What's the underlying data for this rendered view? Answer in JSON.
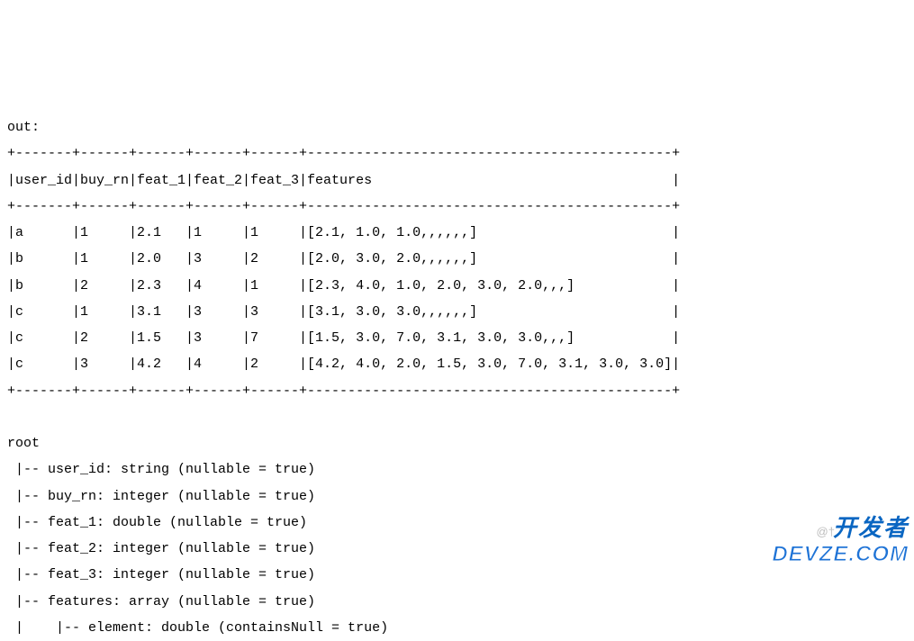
{
  "out_label": "out:",
  "table_border_line": "+-------+------+------+------+------+---------------------------------------------+",
  "table_header_raw": "|user_id|buy_rn|feat_1|feat_2|feat_3|features                                     |",
  "columns": [
    "user_id",
    "buy_rn",
    "feat_1",
    "feat_2",
    "feat_3",
    "features"
  ],
  "rows_raw": [
    "|a      |1     |2.1   |1     |1     |[2.1, 1.0, 1.0,,,,,,]                        |",
    "|b      |1     |2.0   |3     |2     |[2.0, 3.0, 2.0,,,,,,]                        |",
    "|b      |2     |2.3   |4     |1     |[2.3, 4.0, 1.0, 2.0, 3.0, 2.0,,,]            |",
    "|c      |1     |3.1   |3     |3     |[3.1, 3.0, 3.0,,,,,,]                        |",
    "|c      |2     |1.5   |3     |7     |[1.5, 3.0, 7.0, 3.1, 3.0, 3.0,,,]            |",
    "|c      |3     |4.2   |4     |2     |[4.2, 4.0, 2.0, 1.5, 3.0, 7.0, 3.1, 3.0, 3.0]|"
  ],
  "rows": [
    {
      "user_id": "a",
      "buy_rn": 1,
      "feat_1": 2.1,
      "feat_2": 1,
      "feat_3": 1,
      "features": "[2.1, 1.0, 1.0,,,,,,]"
    },
    {
      "user_id": "b",
      "buy_rn": 1,
      "feat_1": 2.0,
      "feat_2": 3,
      "feat_3": 2,
      "features": "[2.0, 3.0, 2.0,,,,,,]"
    },
    {
      "user_id": "b",
      "buy_rn": 2,
      "feat_1": 2.3,
      "feat_2": 4,
      "feat_3": 1,
      "features": "[2.3, 4.0, 1.0, 2.0, 3.0, 2.0,,,]"
    },
    {
      "user_id": "c",
      "buy_rn": 1,
      "feat_1": 3.1,
      "feat_2": 3,
      "feat_3": 3,
      "features": "[3.1, 3.0, 3.0,,,,,,]"
    },
    {
      "user_id": "c",
      "buy_rn": 2,
      "feat_1": 1.5,
      "feat_2": 3,
      "feat_3": 7,
      "features": "[1.5, 3.0, 7.0, 3.1, 3.0, 3.0,,,]"
    },
    {
      "user_id": "c",
      "buy_rn": 3,
      "feat_1": 4.2,
      "feat_2": 4,
      "feat_3": 2,
      "features": "[4.2, 4.0, 2.0, 1.5, 3.0, 7.0, 3.1, 3.0, 3.0]"
    }
  ],
  "schema_header": "root",
  "schema_lines": [
    " |-- user_id: string (nullable = true)",
    " |-- buy_rn: integer (nullable = true)",
    " |-- feat_1: double (nullable = true)",
    " |-- feat_2: integer (nullable = true)",
    " |-- feat_3: integer (nullable = true)",
    " |-- features: array (nullable = true)",
    " |    |-- element: double (containsNull = true)"
  ],
  "schema": [
    {
      "name": "user_id",
      "type": "string",
      "nullable": true
    },
    {
      "name": "buy_rn",
      "type": "integer",
      "nullable": true
    },
    {
      "name": "feat_1",
      "type": "double",
      "nullable": true
    },
    {
      "name": "feat_2",
      "type": "integer",
      "nullable": true
    },
    {
      "name": "feat_3",
      "type": "integer",
      "nullable": true
    },
    {
      "name": "features",
      "type": "array",
      "nullable": true,
      "element_type": "double",
      "containsNull": true
    }
  ],
  "watermark": {
    "sig": "@†",
    "cn": "开发者",
    "lat": "DEVZE.COM"
  }
}
